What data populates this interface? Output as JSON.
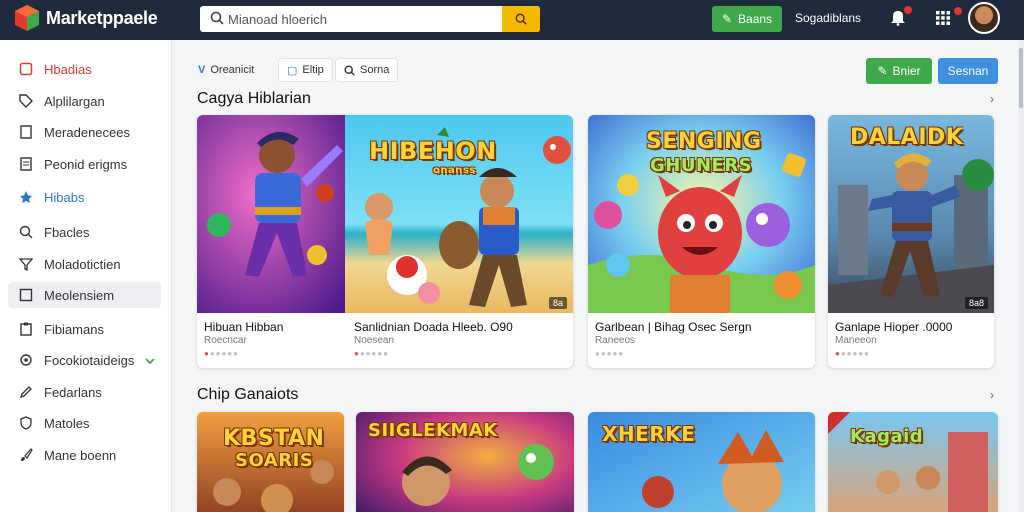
{
  "app": {
    "brand": "Marketppaele"
  },
  "search": {
    "placeholder": "Mianoad hloerich"
  },
  "topbar": {
    "button_label": "Baans",
    "username": "Sogadiblans"
  },
  "sidebar": {
    "items": [
      {
        "label": "Hbadias",
        "icon": "home-icon",
        "state": "red"
      },
      {
        "label": "Alplilargan",
        "icon": "tag-icon",
        "state": ""
      },
      {
        "label": "Meradenecees",
        "icon": "document-icon",
        "state": ""
      },
      {
        "label": "Peonid erigms",
        "icon": "list-icon",
        "state": ""
      },
      {
        "label": "Hibabs",
        "icon": "star-icon",
        "state": "blue"
      },
      {
        "label": "Fbacles",
        "icon": "search-icon",
        "state": ""
      },
      {
        "label": "Moladotictien",
        "icon": "funnel-icon",
        "state": ""
      },
      {
        "label": "Meolensiem",
        "icon": "grid-icon",
        "state": "selected"
      },
      {
        "label": "Fibiamans",
        "icon": "clipboard-icon",
        "state": ""
      },
      {
        "label": "Focokiotaideigs",
        "icon": "settings-icon",
        "state": "",
        "chevron": true
      },
      {
        "label": "Fedarlans",
        "icon": "pencil-icon",
        "state": ""
      },
      {
        "label": "Matoles",
        "icon": "shield-icon",
        "state": ""
      },
      {
        "label": "Mane boenn",
        "icon": "brush-icon",
        "state": ""
      }
    ]
  },
  "filters": [
    {
      "label": "Oreanicit",
      "icon": "v-icon"
    },
    {
      "label": "Eltip",
      "icon": "clipboard-icon"
    },
    {
      "label": "Sorna",
      "icon": "search-icon"
    }
  ],
  "actions": {
    "green_label": "Bnier",
    "blue_label": "Sesnan"
  },
  "sections": [
    {
      "title": "Cagya Hiblarian",
      "cards": [
        {
          "title": "Hibuan Hibban",
          "subtitle": "Roecncar",
          "art_text": "",
          "badge": ""
        },
        {
          "title": "Sanlidnian Doada Hleeb. O90",
          "subtitle": "Noesean",
          "art_text": "HIBEHON",
          "art_sub": "onanss",
          "badge": "8a"
        },
        {
          "title": "Garlbean | Bihag Osec Sergn",
          "subtitle": "Raneeos",
          "art_text": "SENGING",
          "art_sub": "GHUNERS",
          "badge": ""
        },
        {
          "title": "Ganlape Hioper .0000",
          "subtitle": "Maneeon",
          "art_text": "DALAIDK",
          "badge": "8a8"
        }
      ]
    },
    {
      "title": "Chip Ganaiots",
      "cards": [
        {
          "art_text": "KBSTAN",
          "art_sub": "SOARIS"
        },
        {
          "art_text": "SIIGLEKMAK"
        },
        {
          "art_text": "XHERKE"
        },
        {
          "art_text": "Kagaid"
        }
      ]
    }
  ],
  "colors": {
    "topbar": "#1f2a3c",
    "accent_green": "#3fa84a",
    "accent_blue": "#3d8fe0",
    "accent_red": "#d93a33",
    "search_button": "#f5b800"
  }
}
